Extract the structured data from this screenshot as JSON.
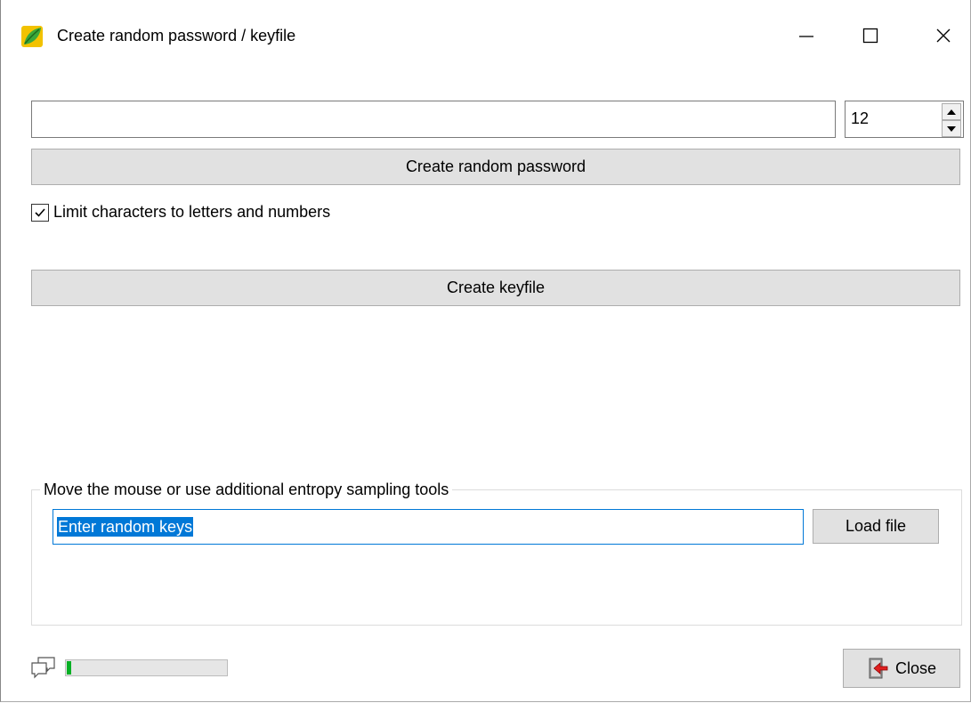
{
  "window": {
    "title": "Create random password / keyfile",
    "controls": {
      "minimize_icon": "minimize-icon",
      "maximize_icon": "maximize-icon",
      "close_icon": "close-x-icon"
    }
  },
  "password": {
    "value": "",
    "length": "12",
    "create_button": "Create random password"
  },
  "limit_checkbox": {
    "label": "Limit characters to letters and numbers",
    "checked": true
  },
  "keyfile": {
    "create_button": "Create keyfile"
  },
  "entropy": {
    "group_label": "Move the mouse or use additional entropy sampling tools",
    "input_value": "Enter random keys",
    "load_button": "Load file"
  },
  "footer": {
    "progress_fraction": 0.03,
    "progress_color": "#06b025",
    "close_button": "Close"
  },
  "colors": {
    "selection": "#0078d7",
    "button_face": "#e1e1e1"
  }
}
